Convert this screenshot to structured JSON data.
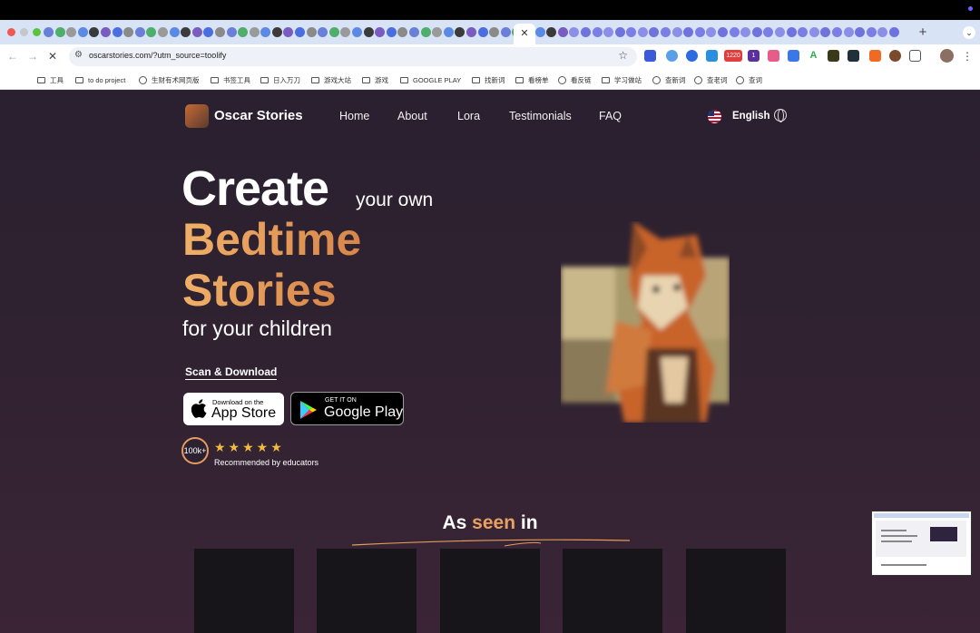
{
  "browser": {
    "active_tab_close": "✕",
    "new_tab": "+",
    "address": "oscarstories.com/?utm_source=toolify",
    "bookmarks": [
      {
        "label": "工具",
        "icon": "folder-icon"
      },
      {
        "label": "to do project",
        "icon": "folder-icon"
      },
      {
        "label": "生财有术网页版",
        "icon": "site-icon"
      },
      {
        "label": "书签工具",
        "icon": "folder-icon"
      },
      {
        "label": "日入万刀",
        "icon": "folder-icon"
      },
      {
        "label": "游戏大站",
        "icon": "folder-icon"
      },
      {
        "label": "游戏",
        "icon": "folder-icon"
      },
      {
        "label": "GOOGLE PLAY",
        "icon": "folder-icon"
      },
      {
        "label": "找新词",
        "icon": "folder-icon"
      },
      {
        "label": "看榜单",
        "icon": "folder-icon"
      },
      {
        "label": "看反链",
        "icon": "globe-icon"
      },
      {
        "label": "学习做站",
        "icon": "folder-icon"
      },
      {
        "label": "查新词",
        "icon": "globe-icon"
      },
      {
        "label": "查老词",
        "icon": "globe-icon"
      },
      {
        "label": "查词",
        "icon": "globe-icon"
      }
    ],
    "extension_badge": "1220",
    "extension_badge2": "1"
  },
  "site": {
    "brand": "Oscar Stories",
    "nav": [
      "Home",
      "About",
      "Lora",
      "Testimonials",
      "FAQ"
    ],
    "language": "English",
    "hero": {
      "create": "Create",
      "your_own": "your own",
      "bedtime": "Bedtime",
      "stories": "Stories",
      "for_children": "for your children"
    },
    "scan_download": "Scan & Download",
    "appstore": {
      "small": "Download on the",
      "big": "App Store"
    },
    "googleplay": {
      "small": "GET IT ON",
      "big": "Google Play"
    },
    "badge": "100k+",
    "stars": "★★★★★",
    "rating_count": 5,
    "recommended": "Recommended by educators",
    "seen_in": {
      "pre": "As ",
      "accent": "seen",
      "post": " in"
    }
  },
  "colors": {
    "accent": "#e8a163",
    "background": "#2a2030",
    "star": "#f4b940"
  }
}
